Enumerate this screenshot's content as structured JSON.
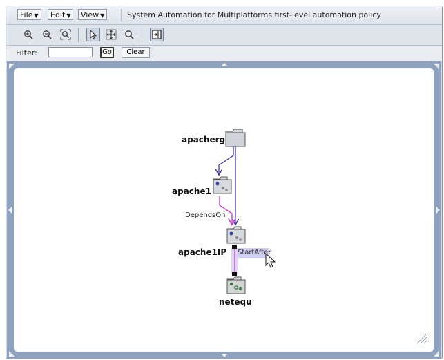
{
  "menubar": {
    "file_label": "File",
    "edit_label": "Edit",
    "view_label": "View",
    "policy_title": "System Automation for Multiplatforms first-level automation policy"
  },
  "toolbar": {
    "tools": [
      "zoom-in-icon",
      "zoom-out-icon",
      "zoom-fit-icon",
      "select-pointer-icon",
      "pan-icon",
      "magnify-icon",
      "fit-window-icon"
    ],
    "selected_tool": "select-pointer-icon"
  },
  "filter": {
    "label": "Filter:",
    "value": "",
    "go_label": "Go",
    "clear_label": "Clear"
  },
  "graph": {
    "nodes": [
      {
        "id": "apacherg",
        "label": "apacherg",
        "type": "resource-group"
      },
      {
        "id": "apache1",
        "label": "apache1",
        "type": "resource"
      },
      {
        "id": "apache1IP",
        "label": "apache1IP",
        "type": "resource"
      },
      {
        "id": "netequ",
        "label": "netequ",
        "type": "equivalency"
      }
    ],
    "edges": [
      {
        "from": "apacherg",
        "to": "apache1",
        "label": "",
        "color": "#3b2fa8"
      },
      {
        "from": "apacherg",
        "to": "apache1IP",
        "label": "",
        "color": "#3b2fa8"
      },
      {
        "from": "apache1",
        "to": "apache1IP",
        "label": "DependsOn",
        "color": "#d040c8"
      },
      {
        "from": "apache1IP",
        "to": "netequ",
        "label": "StartAfter",
        "color": "#c37ad8",
        "selected": true
      }
    ]
  },
  "colors": {
    "canvas_border": "#8ea1bd",
    "depends_on": "#d040c8",
    "membership": "#3b2fa8",
    "selection_highlight": "#c9c6f2"
  }
}
